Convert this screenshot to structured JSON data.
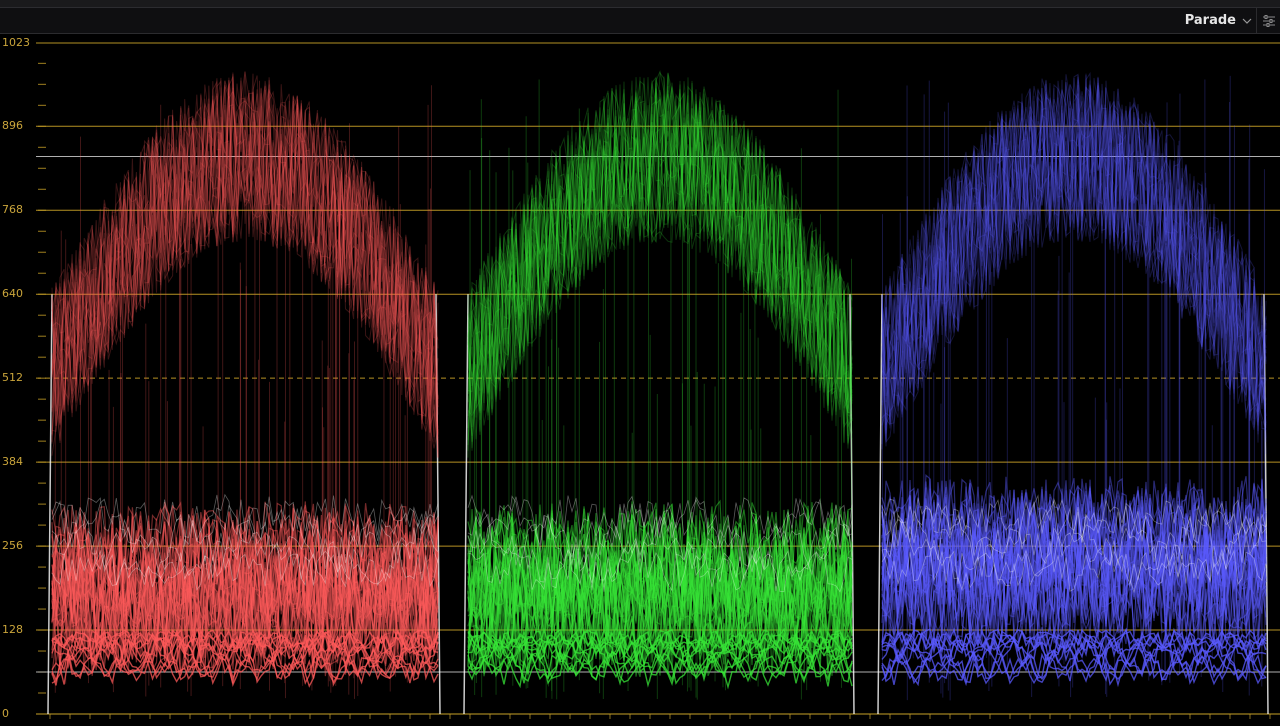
{
  "toolbar": {
    "mode_label": "Parade",
    "mode_icon": "chevron-down-icon",
    "settings_icon": "sliders-icon"
  },
  "scope": {
    "y_axis_labels": [
      "1023",
      "896",
      "768",
      "640",
      "512",
      "384",
      "256",
      "128",
      "0"
    ],
    "guide_color": "#c9a227",
    "reference_line_color": "#cfcfcf",
    "channels": [
      {
        "name": "red",
        "color": "#ff5a5a"
      },
      {
        "name": "green",
        "color": "#37e637"
      },
      {
        "name": "blue",
        "color": "#5a5aff"
      }
    ]
  }
}
